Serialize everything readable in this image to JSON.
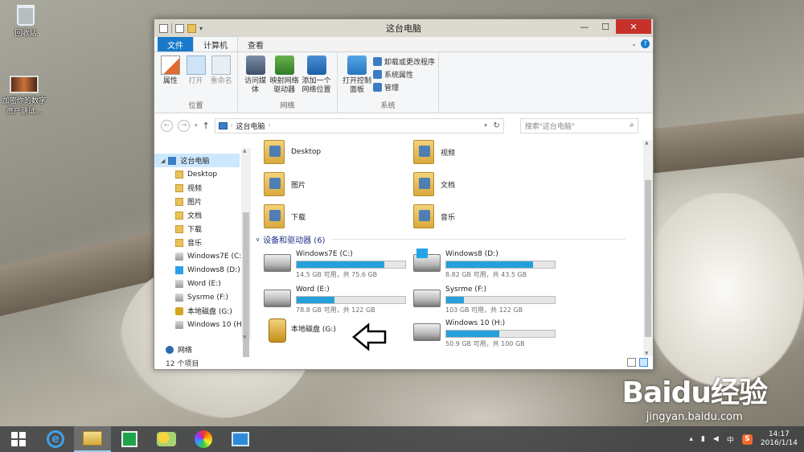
{
  "desktop": {
    "recycle_bin": "回收站",
    "video_label": "加密你的数字资产测试..."
  },
  "window": {
    "title": "这台电脑",
    "tabs": [
      "文件",
      "计算机",
      "查看"
    ],
    "ribbon": {
      "location_group": "位置",
      "network_group": "网络",
      "system_group": "系统",
      "properties": "属性",
      "open": "打开",
      "rename": "重命名",
      "access_media": "访问媒体",
      "map_drive": "映射网络驱动器",
      "add_location": "添加一个网络位置",
      "open_control_panel": "打开控制面板",
      "uninstall": "卸载或更改程序",
      "system_props": "系统属性",
      "manage": "管理"
    },
    "address": "这台电脑",
    "search_placeholder": "搜索\"这台电脑\"",
    "nav": {
      "root": "这台电脑",
      "items": [
        "Desktop",
        "视频",
        "图片",
        "文档",
        "下载",
        "音乐",
        "Windows7E (C:)",
        "Windows8 (D:)",
        "Word (E:)",
        "Sysrme (F:)",
        "本地磁盘 (G:)",
        "Windows 10 (H"
      ],
      "network": "网络"
    },
    "folders": [
      "Desktop",
      "视频",
      "图片",
      "文档",
      "下载",
      "音乐"
    ],
    "section_title": "设备和驱动器 (6)",
    "drives": [
      {
        "name": "Windows7E (C:)",
        "info": "14.5 GB 可用，共 75.6 GB",
        "used_fraction": 0.81
      },
      {
        "name": "Windows8 (D:)",
        "info": "8.82 GB 可用，共 43.5 GB",
        "used_fraction": 0.8
      },
      {
        "name": "Word (E:)",
        "info": "78.8 GB 可用，共 122 GB",
        "used_fraction": 0.35
      },
      {
        "name": "Sysrme (F:)",
        "info": "103 GB 可用，共 122 GB",
        "used_fraction": 0.16
      },
      {
        "name": "本地磁盘 (G:)",
        "info": "",
        "used_fraction": null
      },
      {
        "name": "Windows 10 (H:)",
        "info": "50.9 GB 可用，共 100 GB",
        "used_fraction": 0.49
      }
    ],
    "status": "12 个项目"
  },
  "taskbar": {
    "ime": "中",
    "sogou": "S",
    "time": "14:17",
    "date": "2016/1/14"
  },
  "watermark": {
    "logo": "Baidu经验",
    "url": "jingyan.baidu.com"
  },
  "colors": {
    "accent": "#1979ca",
    "drive_bar": "#26a0da",
    "close": "#c7312b"
  }
}
